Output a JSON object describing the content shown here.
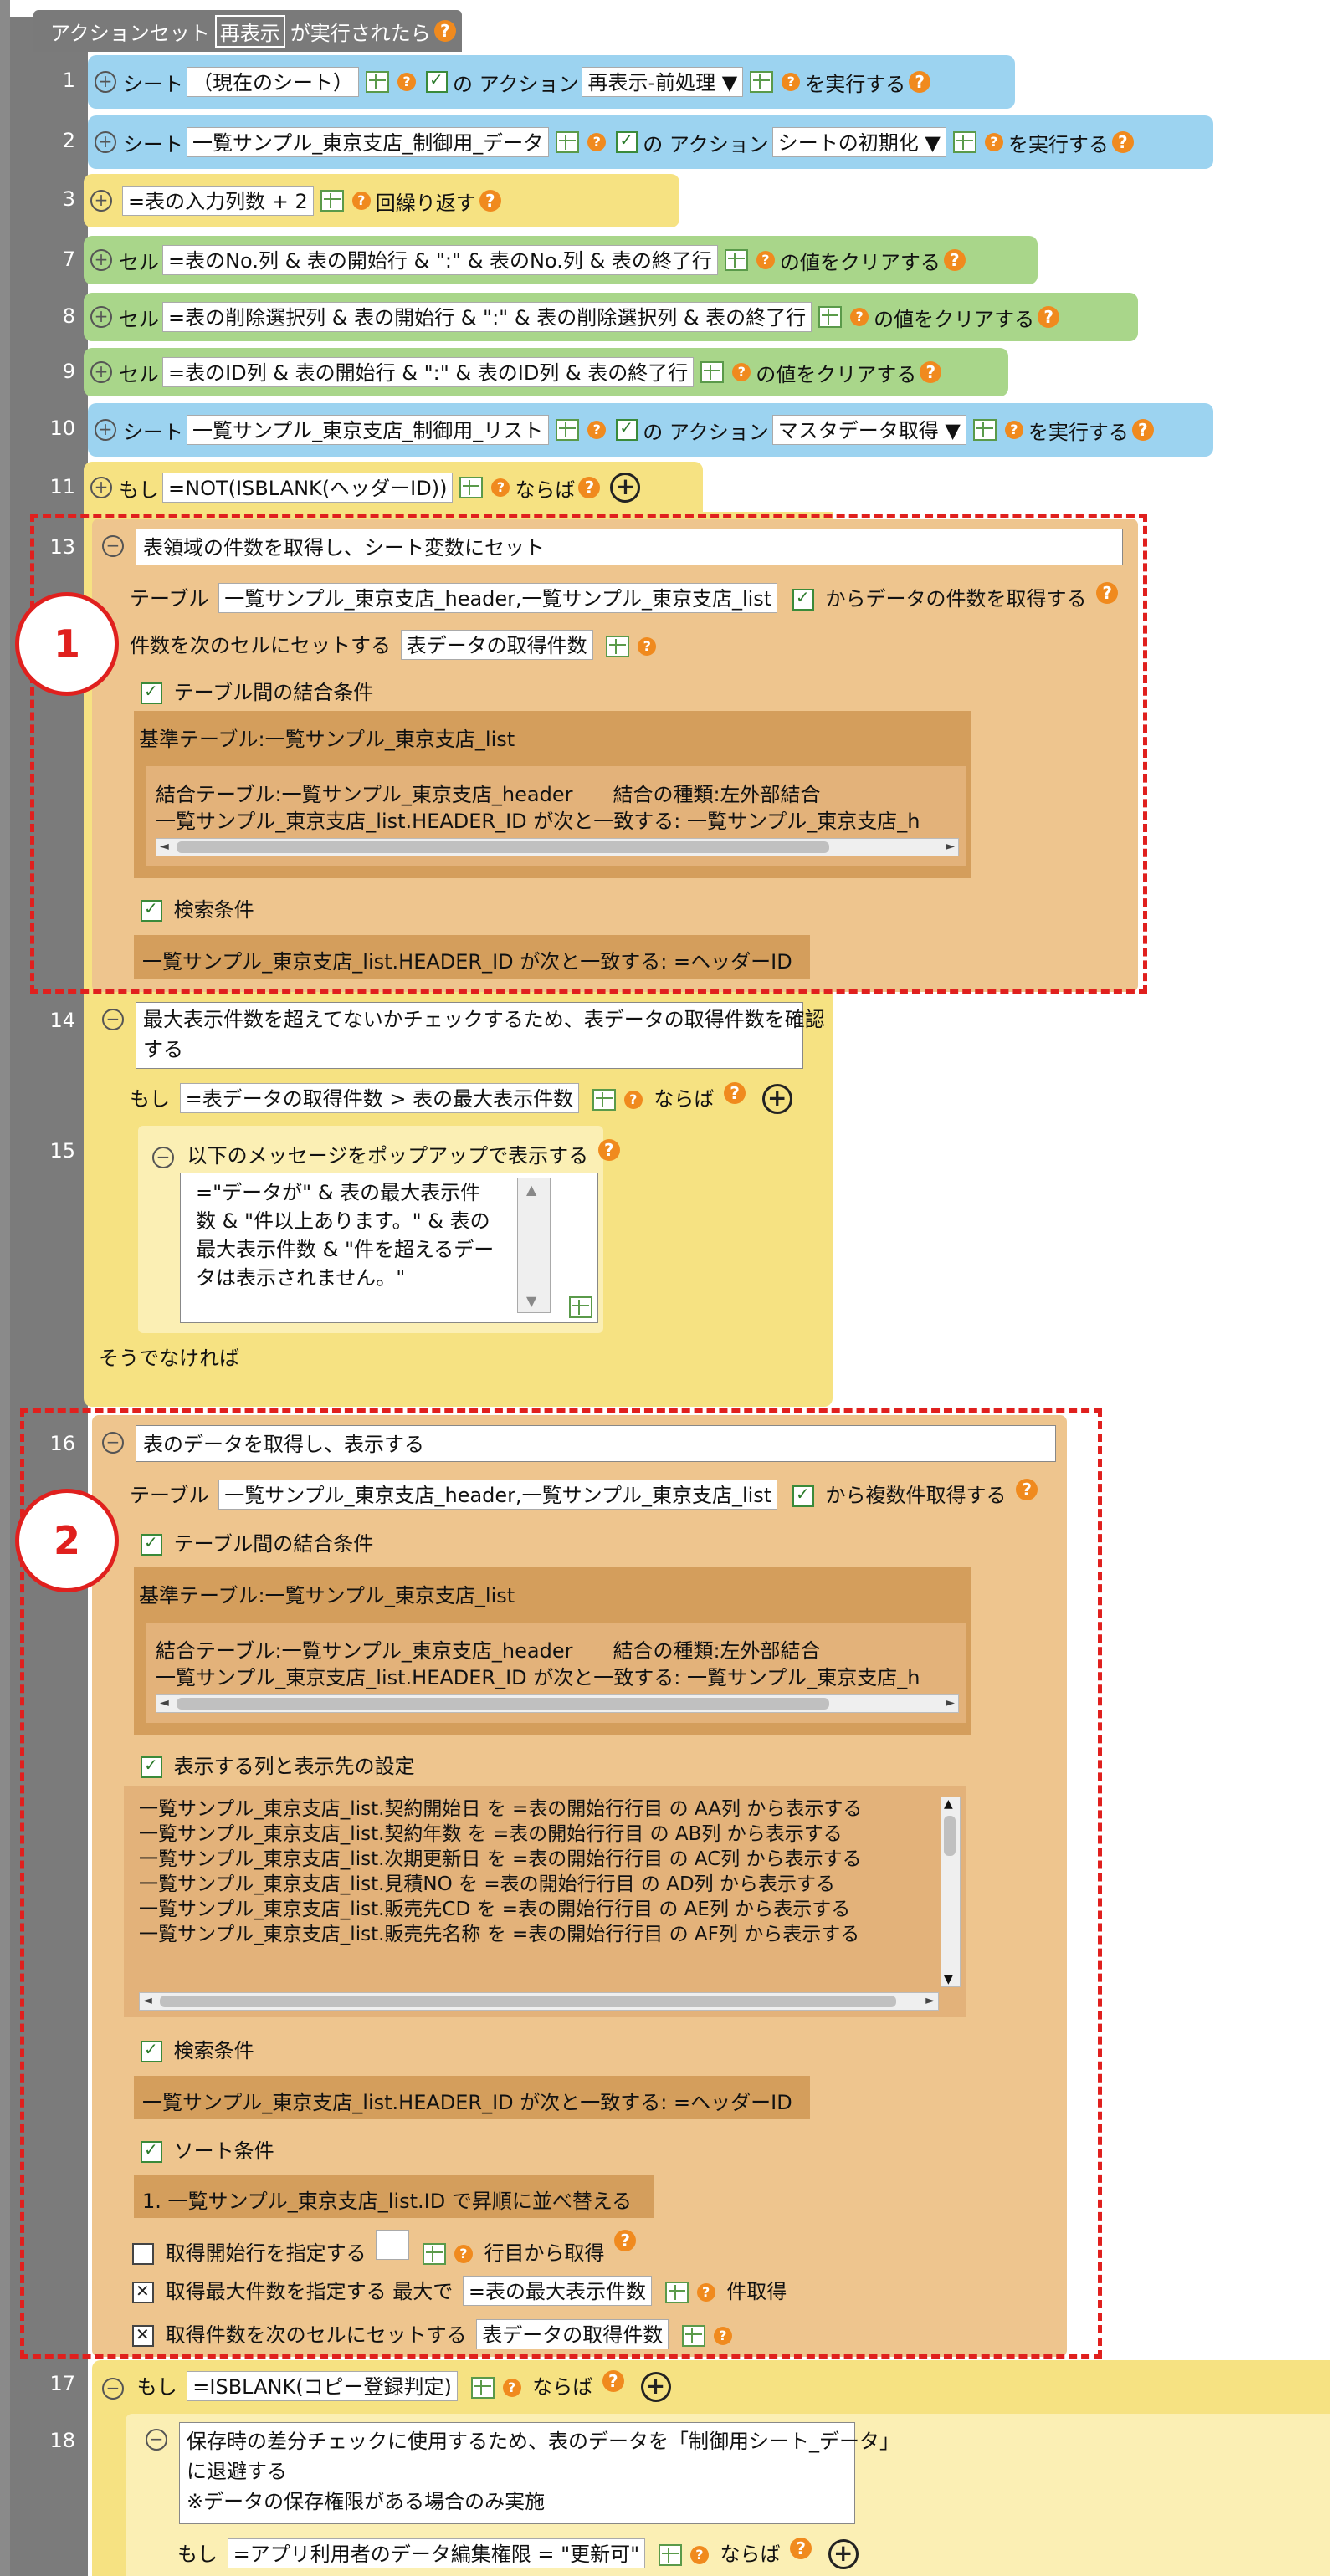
{
  "header": {
    "prefix": "アクションセット",
    "event": "再表示",
    "suffix": "が実行されたら"
  },
  "lines": {
    "l1": "1",
    "l2": "2",
    "l3": "3",
    "l7": "7",
    "l8": "8",
    "l9": "9",
    "l10": "10",
    "l11": "11",
    "l13": "13",
    "l14": "14",
    "l15": "15",
    "l16": "16",
    "l17": "17",
    "l18": "18"
  },
  "r1": {
    "kw": "シート",
    "sheet": "（現在のシート）",
    "of": "の",
    "action_kw": "アクション",
    "action": "再表示-前処理",
    "exec": "を実行する"
  },
  "r2": {
    "kw": "シート",
    "sheet": "一覧サンプル_東京支店_制御用_データ",
    "of": "の",
    "action_kw": "アクション",
    "action": "シートの初期化",
    "exec": "を実行する"
  },
  "r3": {
    "expr": "=表の入力列数 + 2",
    "loop": "回繰り返す"
  },
  "r7": {
    "kw": "セル",
    "expr": "=表のNo.列 & 表の開始行 & \":\" & 表のNo.列 & 表の終了行",
    "clear": "の値をクリアする"
  },
  "r8": {
    "kw": "セル",
    "expr": "=表の削除選択列 & 表の開始行 & \":\" & 表の削除選択列 & 表の終了行",
    "clear": "の値をクリアする"
  },
  "r9": {
    "kw": "セル",
    "expr": "=表のID列 & 表の開始行 & \":\" & 表のID列 & 表の終了行",
    "clear": "の値をクリアする"
  },
  "r10": {
    "kw": "シート",
    "sheet": "一覧サンプル_東京支店_制御用_リスト",
    "of": "の",
    "action_kw": "アクション",
    "action": "マスタデータ取得",
    "exec": "を実行する"
  },
  "r11": {
    "kw": "もし",
    "expr": "=NOT(ISBLANK(ヘッダーID))",
    "then": "ならば"
  },
  "b13": {
    "title": "表領域の件数を取得し、シート変数にセット",
    "table_kw": "テーブル",
    "tables": "一覧サンプル_東京支店_header,一覧サンプル_東京支店_list",
    "count_text": "からデータの件数を取得する",
    "set_kw": "件数を次のセルにセットする",
    "set_cell": "表データの取得件数",
    "join_kw": "テーブル間の結合条件",
    "base": "基準テーブル:一覧サンプル_東京支店_list",
    "join1": "結合テーブル:一覧サンプル_東京支店_header　　結合の種類:左外部結合",
    "join2": "一覧サンプル_東京支店_list.HEADER_ID が次と一致する: 一覧サンプル_東京支店_h",
    "search_kw": "検索条件",
    "search": "一覧サンプル_東京支店_list.HEADER_ID が次と一致する: =ヘッダーID"
  },
  "b14": {
    "title": "最大表示件数を超えてないかチェックするため、表データの取得件数を確認\nする",
    "if_kw": "もし",
    "expr": "=表データの取得件数 > 表の最大表示件数",
    "then": "ならば"
  },
  "b15": {
    "title": "以下のメッセージをポップアップで表示する",
    "msg": "=\"データが\" & 表の最大表示件\n数 & \"件以上あります。\" & 表の\n最大表示件数 & \"件を超えるデー\nタは表示されません。\"",
    "else": "そうでなければ"
  },
  "b16": {
    "title": "表のデータを取得し、表示する",
    "table_kw": "テーブル",
    "tables": "一覧サンプル_東京支店_header,一覧サンプル_東京支店_list",
    "multi_text": "から複数件取得する",
    "join_kw": "テーブル間の結合条件",
    "base": "基準テーブル:一覧サンプル_東京支店_list",
    "join1": "結合テーブル:一覧サンプル_東京支店_header　　結合の種類:左外部結合",
    "join2": "一覧サンプル_東京支店_list.HEADER_ID が次と一致する: 一覧サンプル_東京支店_h",
    "cols_kw": "表示する列と表示先の設定",
    "cols": [
      "一覧サンプル_東京支店_list.契約開始日 を =表の開始行行目 の AA列 から表示する",
      "一覧サンプル_東京支店_list.契約年数 を =表の開始行行目 の AB列 から表示する",
      "一覧サンプル_東京支店_list.次期更新日 を =表の開始行行目 の AC列 から表示する",
      "一覧サンプル_東京支店_list.見積NO を =表の開始行行目 の AD列 から表示する",
      "一覧サンプル_東京支店_list.販売先CD を =表の開始行行目 の AE列 から表示する",
      "一覧サンプル_東京支店_list.販売先名称 を =表の開始行行目 の AF列 から表示する"
    ],
    "search_kw": "検索条件",
    "search": "一覧サンプル_東京支店_list.HEADER_ID が次と一致する: =ヘッダーID",
    "sort_kw": "ソート条件",
    "sort": "1. 一覧サンプル_東京支店_list.ID で昇順に並べ替える",
    "start_kw": "取得開始行を指定する",
    "start_suffix": "行目から取得",
    "max_kw": "取得最大件数を指定する",
    "max_label": "最大で",
    "max_expr": "=表の最大表示件数",
    "max_suffix": "件取得",
    "set_kw": "取得件数を次のセルにセットする",
    "set_cell": "表データの取得件数"
  },
  "r17": {
    "kw": "もし",
    "expr": "=ISBLANK(コピー登録判定)",
    "then": "ならば"
  },
  "b18": {
    "title": "保存時の差分チェックに使用するため、表のデータを「制御用シート_データ」\nに退避する\n※データの保存権限がある場合のみ実施",
    "if_kw": "もし",
    "expr": "=アプリ利用者のデータ編集権限 = \"更新可\"",
    "then": "ならば"
  },
  "markers": {
    "m1": "1",
    "m2": "2"
  }
}
